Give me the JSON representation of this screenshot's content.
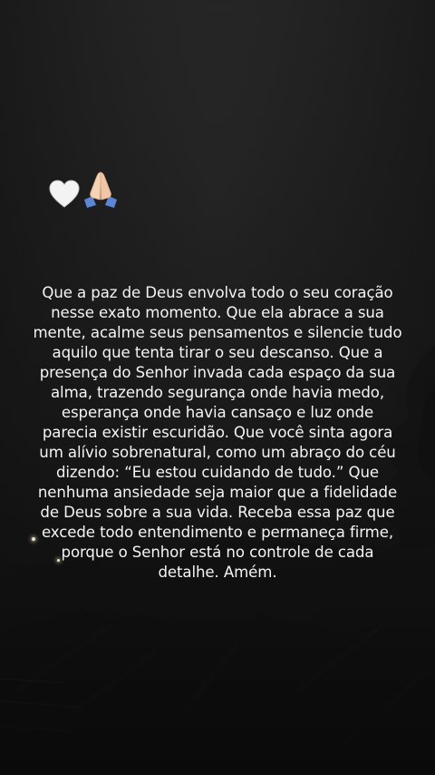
{
  "story": {
    "emoji_left": "white-heart",
    "emoji_right": "folded-hands",
    "caption": "Que a paz de Deus envolva todo o seu coração\nnesse exato momento. Que ela abrace a sua\nmente, acalme seus pensamentos e silencie tudo\naquilo que tenta tirar o seu descanso. Que a\npresença do Senhor invada cada espaço da sua\nalma, trazendo segurança onde havia medo,\nesperança onde havia cansaço e luz onde\nparecia existir escuridão. Que você sinta agora\num alívio sobrenatural, como um abraço do céu\ndizendo: “Eu estou cuidando de tudo.” Que\nnenhuma ansiedade seja maior que a fidelidade\nde Deus sobre a sua vida. Receba essa paz que\nexcede todo entendimento e permaneça firme,\nporque o Senhor está no controle de cada\ndetalhe. Amém."
  },
  "colors": {
    "sky": "#222222",
    "foliage": "#0c0c0c",
    "text": "#f4f4f4"
  }
}
